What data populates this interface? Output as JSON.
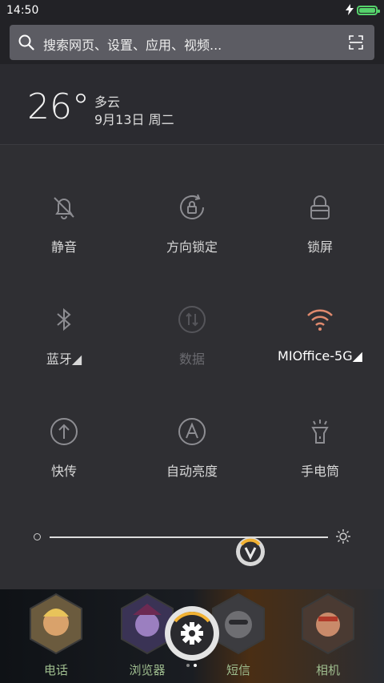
{
  "status_bar": {
    "time": "14:50",
    "battery_color": "#55d26b"
  },
  "search": {
    "placeholder": "搜索网页、设置、应用、视频..."
  },
  "weather": {
    "temperature": "26°",
    "condition": "多云",
    "date": "9月13日 周二"
  },
  "toggles": [
    {
      "label": "静音",
      "icon": "bell-off-icon",
      "state": "off"
    },
    {
      "label": "方向锁定",
      "icon": "rotation-lock-icon",
      "state": "off"
    },
    {
      "label": "锁屏",
      "icon": "lock-icon",
      "state": "off"
    },
    {
      "label": "蓝牙◢",
      "icon": "bluetooth-icon",
      "state": "off"
    },
    {
      "label": "数据",
      "icon": "data-icon",
      "state": "disabled"
    },
    {
      "label": "MIOffice-5G◢",
      "icon": "wifi-icon",
      "state": "on"
    },
    {
      "label": "快传",
      "icon": "share-icon",
      "state": "off"
    },
    {
      "label": "自动亮度",
      "icon": "auto-brightness-icon",
      "state": "off"
    },
    {
      "label": "手电筒",
      "icon": "flashlight-icon",
      "state": "off"
    }
  ],
  "brightness": {
    "level": 0.72,
    "accent": "#f2b233"
  },
  "dock": {
    "apps": [
      {
        "label": "电话"
      },
      {
        "label": "浏览器"
      },
      {
        "label": "短信"
      },
      {
        "label": "相机"
      }
    ],
    "page_count": 2,
    "current_page": 2
  },
  "colors": {
    "wifi_on": "#e08a6e",
    "panel": "#2f2f33"
  }
}
